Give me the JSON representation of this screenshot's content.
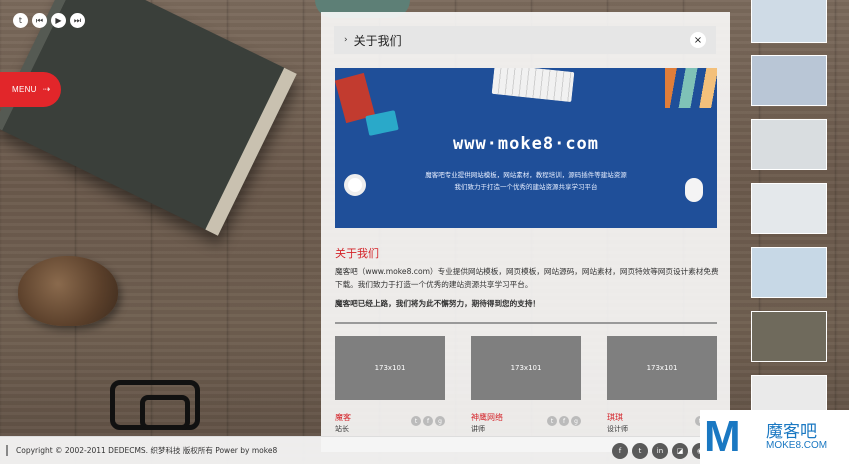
{
  "top_icons": [
    "twitter-icon",
    "skip-back-icon",
    "play-icon",
    "skip-forward-icon"
  ],
  "menu": {
    "label": "MENU",
    "arrow": "⇢"
  },
  "panel": {
    "title": "关于我们",
    "close": "×",
    "banner": {
      "url": "www·moke8·com",
      "line1": "魔客吧专业提供网站模板，网站素材，教程培训，源码插件等建站资源",
      "line2": "我们致力于打造一个优秀的建站资源共享学习平台"
    },
    "section_title": "关于我们",
    "section_body": "魔客吧（www.moke8.com）专业提供网站模板，网页模板，网站源码，网站素材，网页特效等网页设计素材免费下载。我们致力于打造一个优秀的建站资源共享学习平台。",
    "section_bold": "魔客吧已经上路，我们将为此不懈努力，期待得到您的支持！",
    "team": [
      {
        "thumb": "173x101",
        "name": "魔客",
        "role": "站长"
      },
      {
        "thumb": "173x101",
        "name": "神鹰网络",
        "role": "讲师"
      },
      {
        "thumb": "173x101",
        "name": "琪琪",
        "role": "设计师"
      }
    ]
  },
  "gallery_colors": [
    "#cfdbe6",
    "#b9c6d6",
    "#d9dde0",
    "#e4e8eb",
    "#c7d8e6",
    "#6f6a5c",
    "#eaeaea"
  ],
  "footer": {
    "copyright": "Copyright © 2002-2011 DEDECMS. 织梦科技 版权所有 Power by moke8",
    "social": [
      "facebook-icon",
      "twitter-icon",
      "linkedin-icon",
      "delicious-icon",
      "rss-icon",
      "pinterest-icon"
    ]
  },
  "logo": {
    "name": "魔客吧",
    "domain": "MOKE8.COM"
  }
}
